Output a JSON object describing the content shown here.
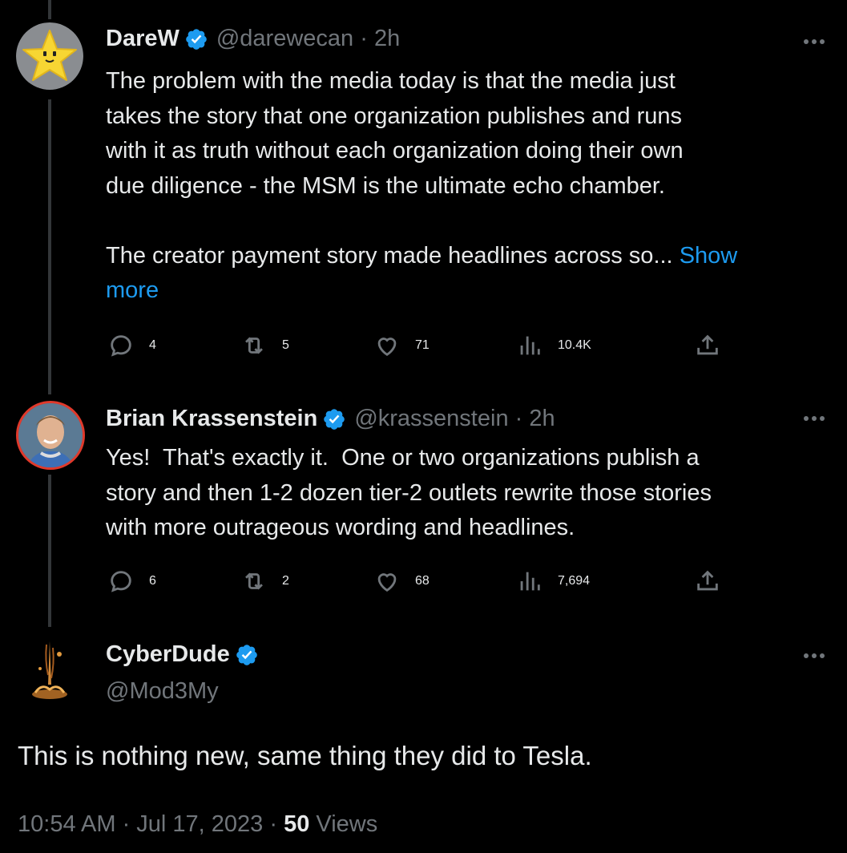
{
  "tweets": [
    {
      "name": "DareW",
      "handle": "@darewecan · 2h",
      "text": "The problem with the media today is that the media just\ntakes the story that one organization publishes and runs\nwith it as truth without each organization doing their own\ndue diligence - the MSM is the ultimate echo chamber.\n\nThe creator payment story made headlines across so...",
      "show_more": "Show\nmore",
      "replies": "4",
      "retweets": "5",
      "likes": "71",
      "views": "10.4K"
    },
    {
      "name": "Brian Krassenstein",
      "handle": "@krassenstein · 2h",
      "text": "Yes!  That's exactly it.  One or two organizations publish a\nstory and then 1-2 dozen tier-2 outlets rewrite those stories\nwith more outrageous wording and headlines.",
      "replies": "6",
      "retweets": "2",
      "likes": "68",
      "views": "7,694"
    }
  ],
  "main_tweet": {
    "name": "CyberDude",
    "handle": "@Mod3My",
    "text": "This is nothing new, same thing they did to Tesla.",
    "timestamp": "10:54 AM · Jul 17, 2023 · ",
    "views_count": "50",
    "views_label": " Views"
  },
  "colors": {
    "background": "#000000",
    "text": "#e7e9ea",
    "muted": "#71767b",
    "link": "#1d9bf0",
    "verified": "#1d9bf0"
  },
  "icons": [
    "verified-badge-icon",
    "more-icon",
    "reply-icon",
    "retweet-icon",
    "like-icon",
    "views-icon",
    "share-icon"
  ]
}
